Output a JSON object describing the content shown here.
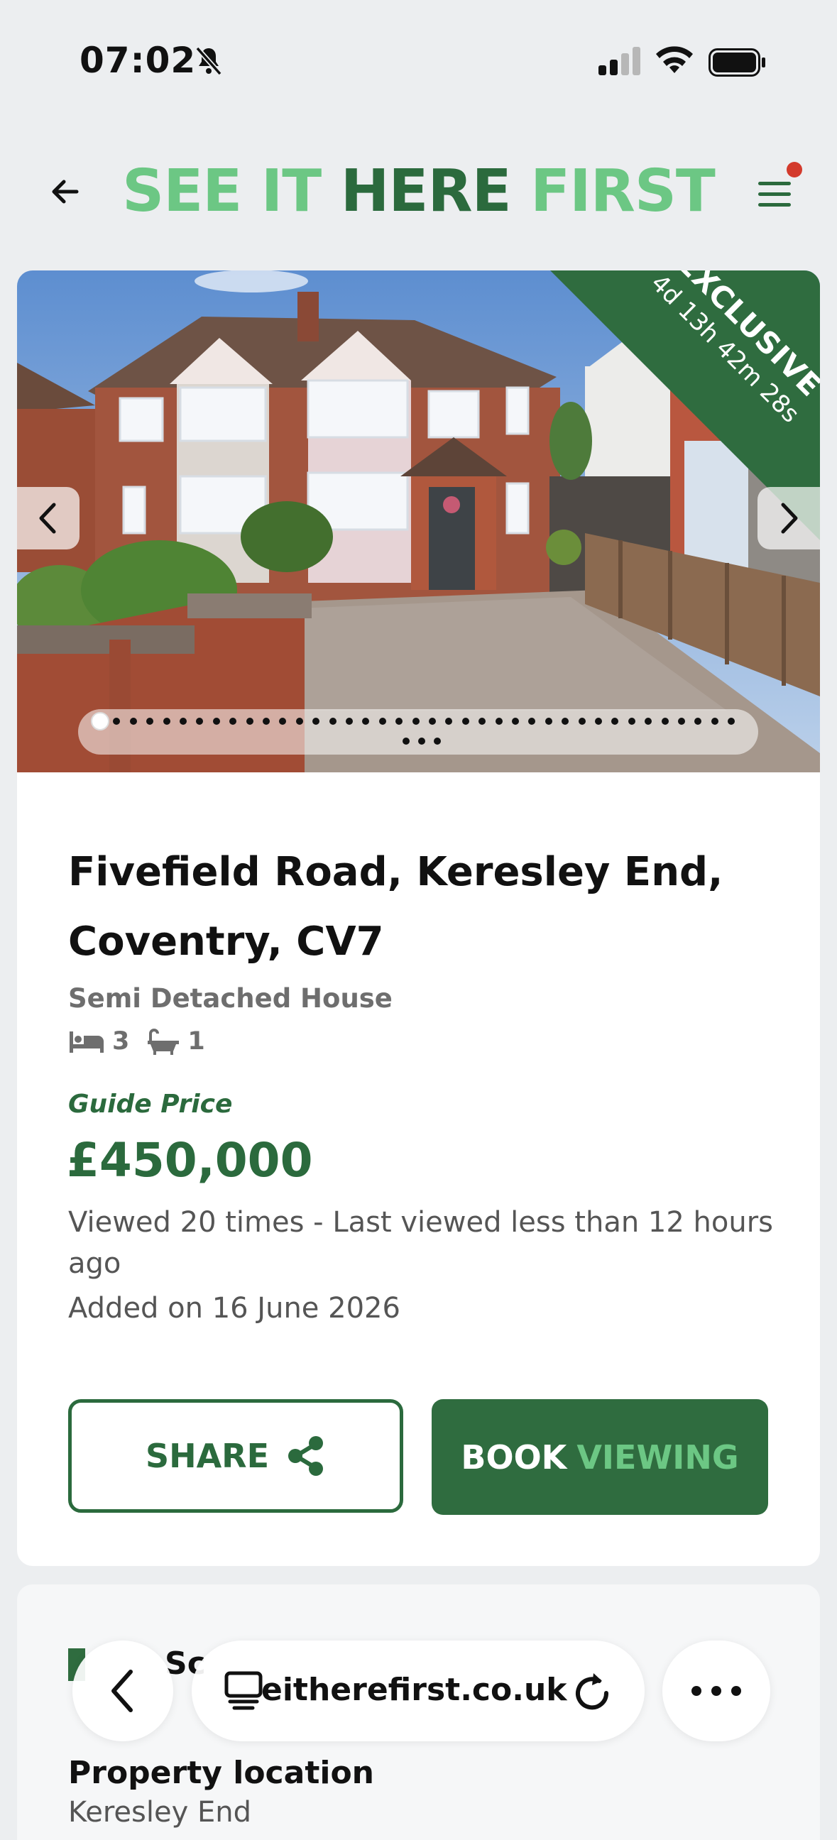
{
  "status": {
    "time": "07:02"
  },
  "header": {
    "logo_part1": "SEE IT",
    "logo_part2": "HERE",
    "logo_part3": "FIRST"
  },
  "gallery": {
    "badge": "EXCLUSIVE",
    "timer": "4d 13h 42m 28s",
    "photo_count": 42,
    "active_photo_index": 1
  },
  "listing": {
    "title": "Fivefield Road, Keresley End, Coventry, CV7",
    "property_type": "Semi Detached House",
    "bedrooms": "3",
    "bathrooms": "1",
    "price_label": "Guide Price",
    "price": "£450,000",
    "views": "Viewed 20 times - Last viewed less than 12 hours ago",
    "added": "Added on 16 June 2026"
  },
  "actions": {
    "share": "SHARE",
    "book_1": "BOOK",
    "book_2": "VIEWING"
  },
  "section": {
    "partial_heading": "Sc",
    "location_title": "Property location",
    "location_sub": "Keresley End"
  },
  "browser": {
    "url": "eitherefirst.co.uk"
  }
}
